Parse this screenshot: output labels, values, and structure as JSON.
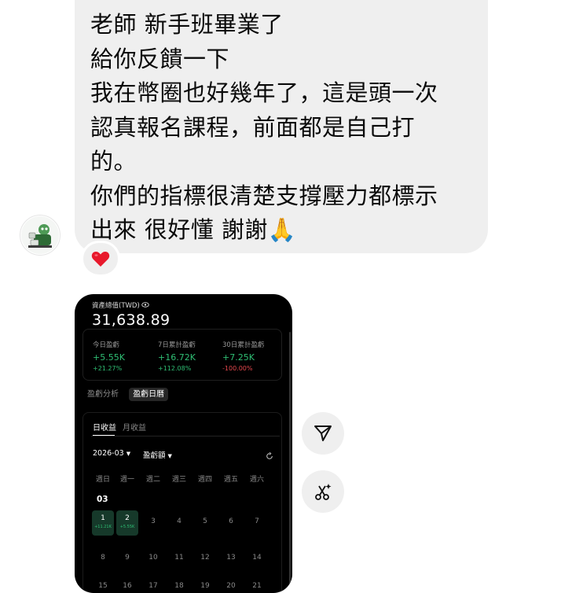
{
  "message": {
    "lines": [
      "老師 新手班畢業了",
      "給你反饋一下",
      "我在幣圈也好幾年了，這是頭一次",
      "認真報名課程，前面都是自己打",
      "的。",
      "你們的指標很清楚支撐壓力都標示",
      "出來 很好懂 謝謝🙏"
    ],
    "reaction": "❤️"
  },
  "app": {
    "asset_label": "資產總值(TWD)",
    "asset_value": "31,638.89",
    "stats": [
      {
        "label": "今日盈虧",
        "value": "+5.55K",
        "pct": "+21.27%"
      },
      {
        "label": "7日累計盈虧",
        "value": "+16.72K",
        "pct": "+112.08%"
      },
      {
        "label": "30日累計盈虧",
        "value": "+7.25K",
        "pct": "-100.00%"
      }
    ],
    "section_tabs": [
      "盈虧分析",
      "盈虧日曆"
    ],
    "calendar_tabs": [
      "日收益",
      "月收益"
    ],
    "month": "2026-03",
    "metric": "盈虧額",
    "weekdays": [
      "週日",
      "週一",
      "週二",
      "週三",
      "週四",
      "週五",
      "週六"
    ],
    "month_label": "03",
    "days": [
      {
        "d": "1",
        "pnl": "+11.21K"
      },
      {
        "d": "2",
        "pnl": "+5.55K"
      },
      {
        "d": "3"
      },
      {
        "d": "4"
      },
      {
        "d": "5"
      },
      {
        "d": "6"
      },
      {
        "d": "7"
      },
      {
        "d": "8"
      },
      {
        "d": "9"
      },
      {
        "d": "10"
      },
      {
        "d": "11"
      },
      {
        "d": "12"
      },
      {
        "d": "13"
      },
      {
        "d": "14"
      },
      {
        "d": "15"
      },
      {
        "d": "16"
      },
      {
        "d": "17"
      },
      {
        "d": "18"
      },
      {
        "d": "19"
      },
      {
        "d": "20"
      },
      {
        "d": "21"
      }
    ]
  },
  "actions": {
    "share_icon": "send-icon",
    "ai_edit_icon": "scissors-sparkle-icon"
  }
}
